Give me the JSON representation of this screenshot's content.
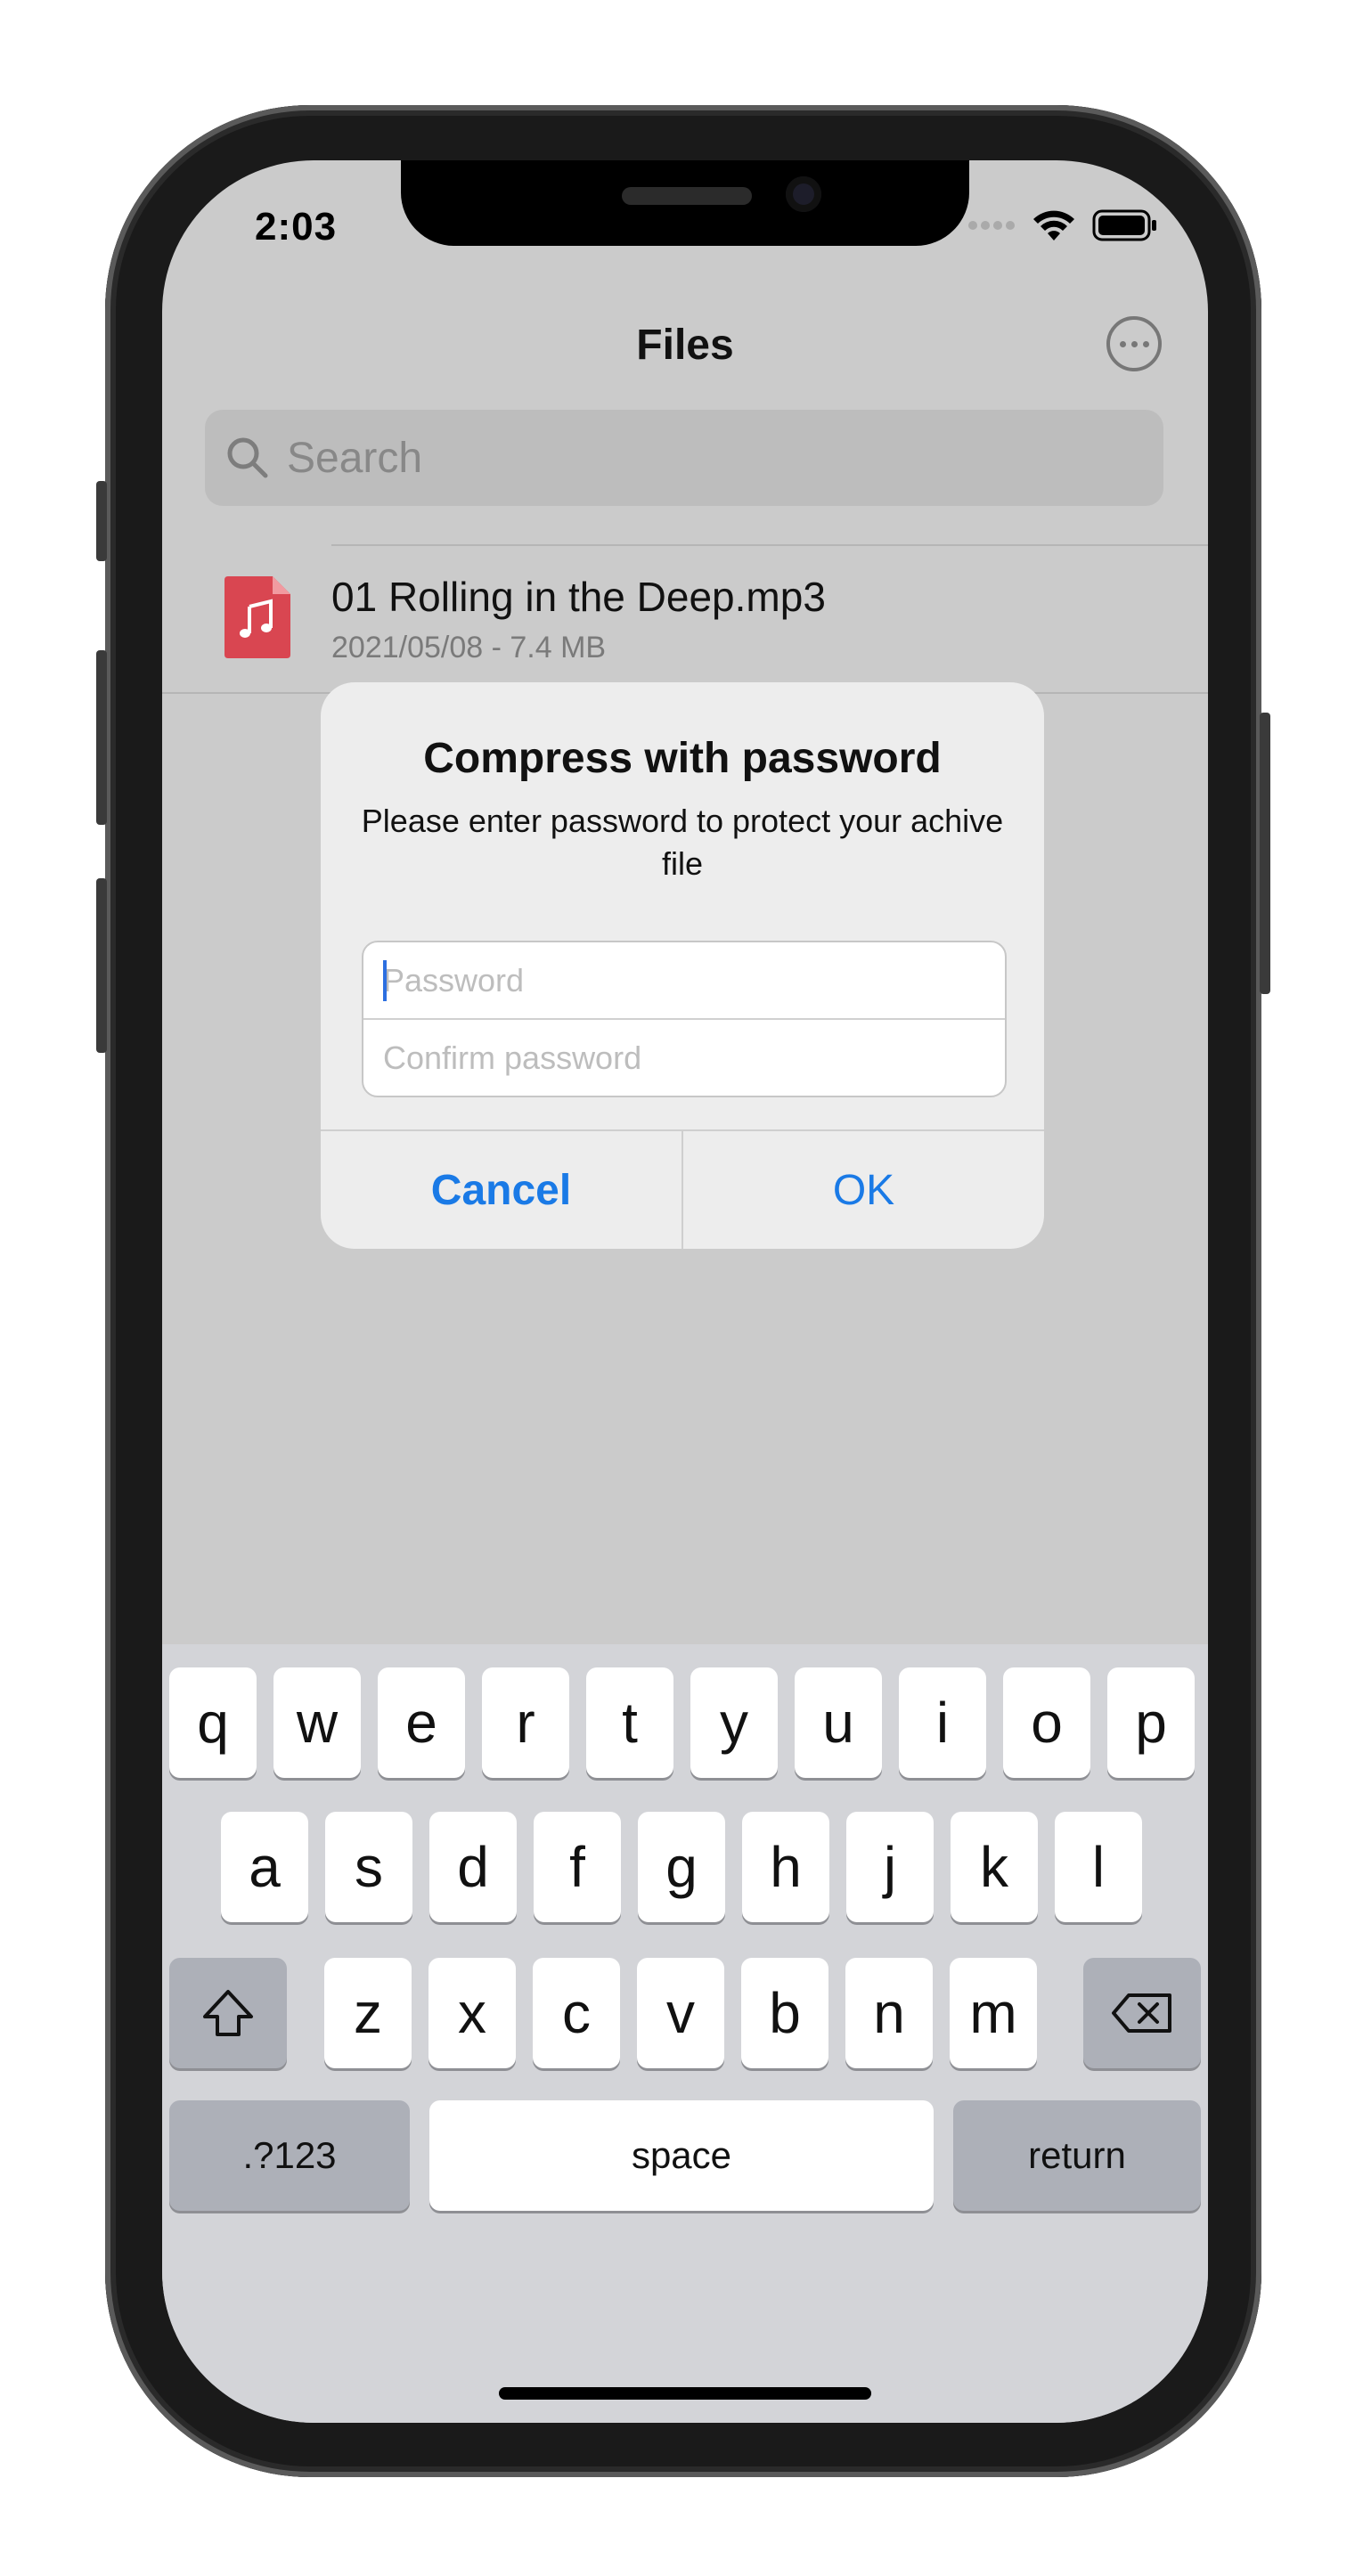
{
  "status_bar": {
    "time": "2:03"
  },
  "nav": {
    "title": "Files",
    "more_icon": "ellipsis-circle-icon"
  },
  "search": {
    "placeholder": "Search"
  },
  "file": {
    "name": "01 Rolling in the Deep.mp3",
    "meta": "2021/05/08 - 7.4 MB",
    "icon": "music-file-icon",
    "icon_color": "#d94651"
  },
  "dialog": {
    "title": "Compress with password",
    "message": "Please enter password to protect your achive file",
    "password_placeholder": "Password",
    "confirm_placeholder": "Confirm password",
    "cancel_label": "Cancel",
    "ok_label": "OK",
    "accent_color": "#1a7ae6"
  },
  "keyboard": {
    "row1": [
      "q",
      "w",
      "e",
      "r",
      "t",
      "y",
      "u",
      "i",
      "o",
      "p"
    ],
    "row2": [
      "a",
      "s",
      "d",
      "f",
      "g",
      "h",
      "j",
      "k",
      "l"
    ],
    "row3": [
      "z",
      "x",
      "c",
      "v",
      "b",
      "n",
      "m"
    ],
    "numbers_label": ".?123",
    "space_label": "space",
    "return_label": "return"
  }
}
